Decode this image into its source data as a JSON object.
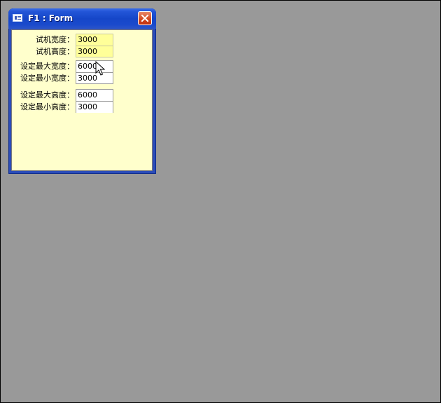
{
  "window": {
    "title": "F1 : Form"
  },
  "form": {
    "fields": [
      {
        "label": "试机宽度：",
        "value": "3000"
      },
      {
        "label": "试机高度：",
        "value": "3000"
      },
      {
        "label": "设定最大宽度：",
        "value": "6000"
      },
      {
        "label": "设定最小宽度：",
        "value": "3000"
      },
      {
        "label": "设定最大高度：",
        "value": "6000"
      },
      {
        "label": "设定最小高度：",
        "value": "3000"
      }
    ]
  },
  "colors": {
    "desktop": "#999999",
    "form_background": "#ffffcc",
    "readonly_field": "#ffff99",
    "titlebar": "#1546c8",
    "close_button": "#d2461c"
  },
  "icons": [
    "form-window-icon",
    "close-x-icon",
    "mouse-pointer-icon"
  ]
}
